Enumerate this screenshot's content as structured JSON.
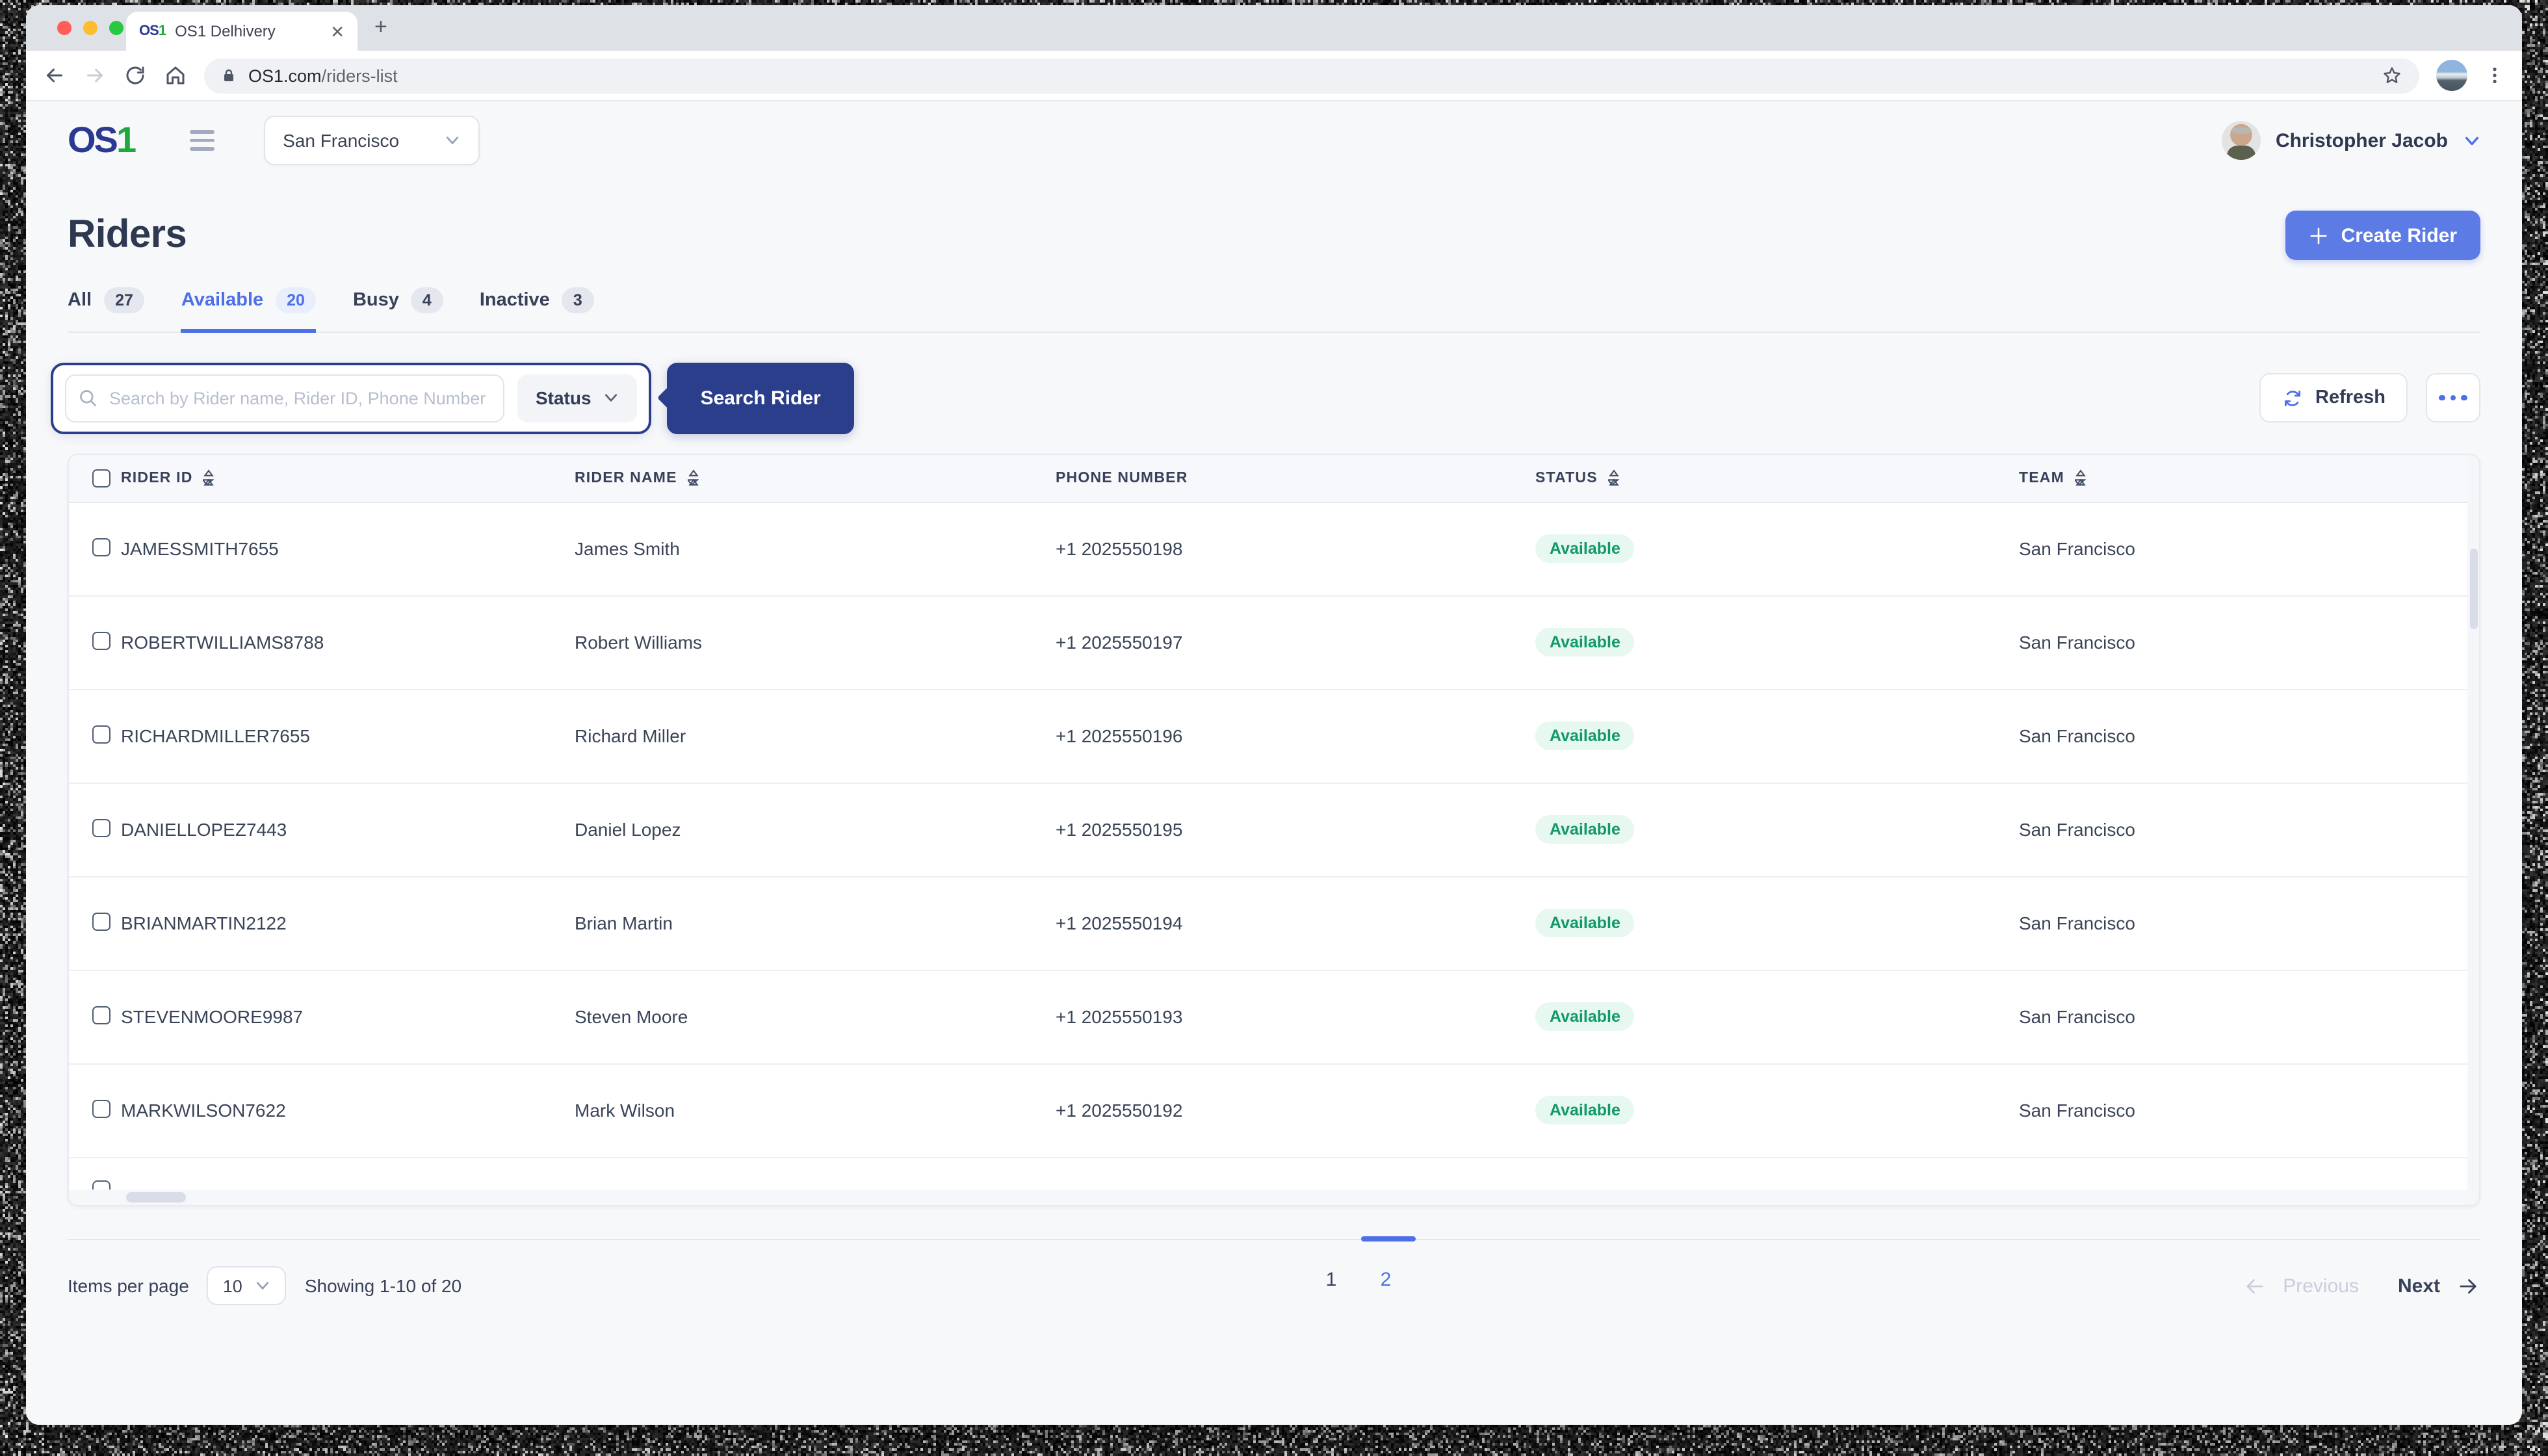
{
  "browser": {
    "tab": {
      "favicon_os": "OS",
      "favicon_one": "1",
      "title": "OS1 Delhivery"
    },
    "url_domain": "OS1.com",
    "url_path": "/riders-list"
  },
  "header": {
    "logo_os": "OS",
    "logo_one": "1",
    "location": "San Francisco",
    "user_name": "Christopher Jacob"
  },
  "page": {
    "title": "Riders",
    "create_button": "Create Rider",
    "tabs": [
      {
        "label": "All",
        "count": "27",
        "active": false
      },
      {
        "label": "Available",
        "count": "20",
        "active": true
      },
      {
        "label": "Busy",
        "count": "4",
        "active": false
      },
      {
        "label": "Inactive",
        "count": "3",
        "active": false
      }
    ],
    "search": {
      "placeholder": "Search by Rider name, Rider ID, Phone Number",
      "status_label": "Status",
      "button": "Search Rider"
    },
    "refresh_label": "Refresh"
  },
  "table": {
    "columns": [
      {
        "label": "Rider ID",
        "sortable": true
      },
      {
        "label": "Rider Name",
        "sortable": true
      },
      {
        "label": "Phone Number",
        "sortable": false
      },
      {
        "label": "Status",
        "sortable": true
      },
      {
        "label": "Team",
        "sortable": true
      }
    ],
    "rows": [
      {
        "id": "JAMESSMITH7655",
        "name": "James Smith",
        "phone": "+1 2025550198",
        "status": "Available",
        "team": "San Francisco"
      },
      {
        "id": "ROBERTWILLIAMS8788",
        "name": "Robert Williams",
        "phone": "+1 2025550197",
        "status": "Available",
        "team": "San Francisco"
      },
      {
        "id": "RICHARDMILLER7655",
        "name": "Richard Miller",
        "phone": "+1 2025550196",
        "status": "Available",
        "team": "San Francisco"
      },
      {
        "id": "DANIELLOPEZ7443",
        "name": "Daniel Lopez",
        "phone": "+1 2025550195",
        "status": "Available",
        "team": "San Francisco"
      },
      {
        "id": "BRIANMARTIN2122",
        "name": "Brian Martin",
        "phone": "+1 2025550194",
        "status": "Available",
        "team": "San Francisco"
      },
      {
        "id": "STEVENMOORE9987",
        "name": "Steven Moore",
        "phone": "+1 2025550193",
        "status": "Available",
        "team": "San Francisco"
      },
      {
        "id": "MARKWILSON7622",
        "name": "Mark Wilson",
        "phone": "+1 2025550192",
        "status": "Available",
        "team": "San Francisco"
      }
    ]
  },
  "pagination": {
    "items_per_page_label": "Items per page",
    "items_per_page_value": "10",
    "showing": "Showing 1-10 of 20",
    "pages": [
      "1",
      "2"
    ],
    "active_page": "2",
    "previous": "Previous",
    "next": "Next"
  },
  "colors": {
    "accent_blue": "#4D6FE8",
    "button_blue": "#5C7BE5",
    "navy": "#2B3E8C",
    "logo_navy": "#2B3990",
    "logo_green": "#1FA93D",
    "status_green": "#12996B",
    "status_green_bg": "#E7F8F0",
    "page_bg": "#F7F8FA",
    "tabstrip_gray": "#DEE1E6"
  }
}
